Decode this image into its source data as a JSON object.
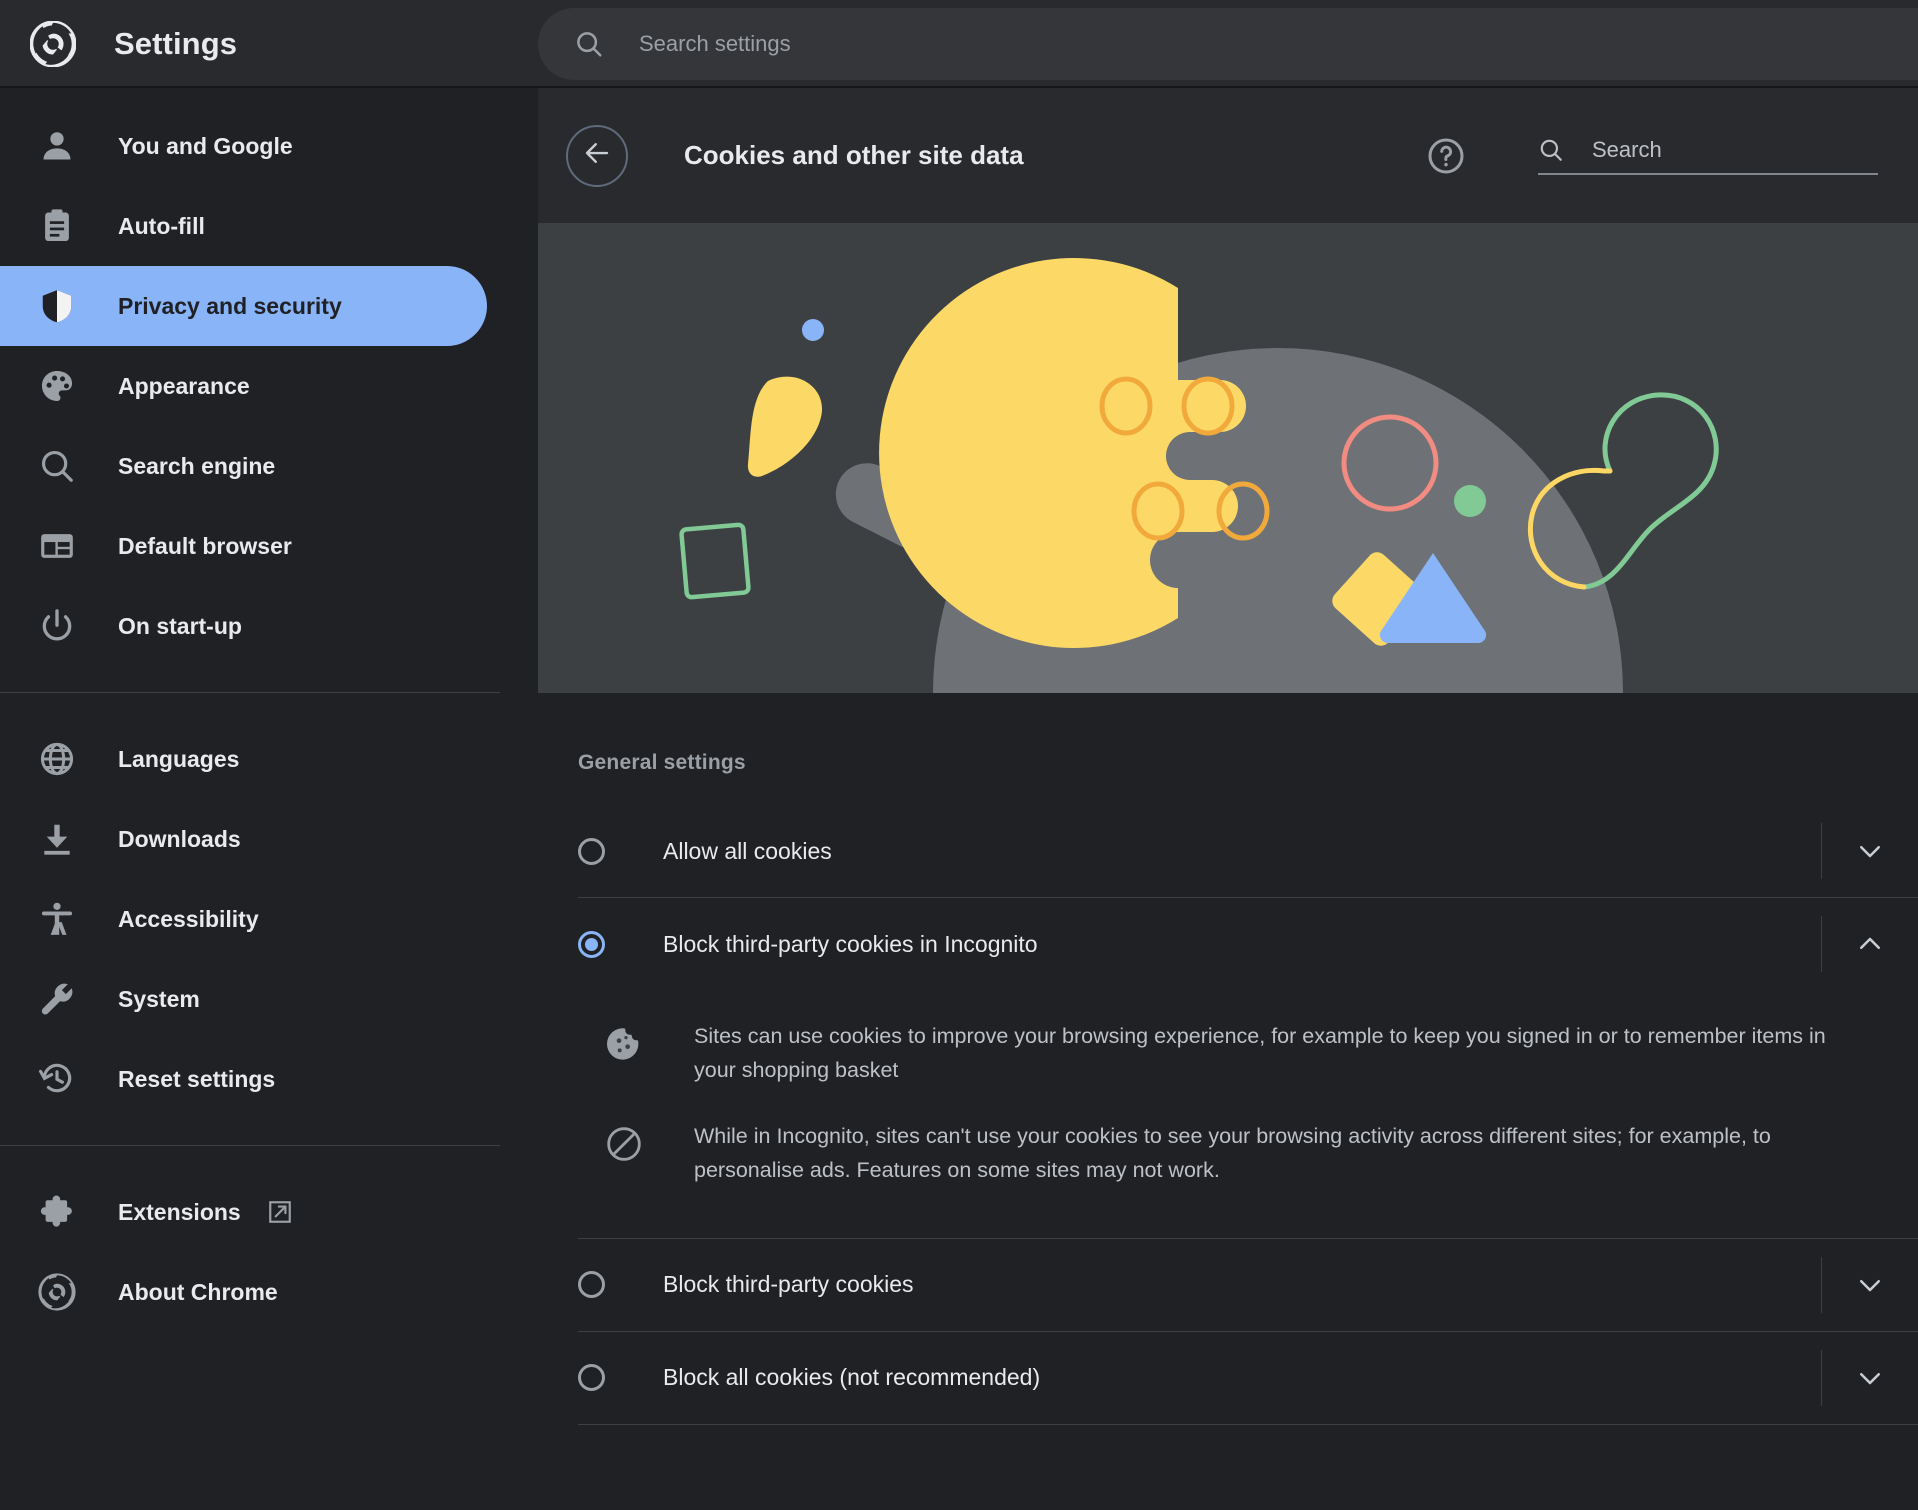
{
  "window": {
    "app_title": "Settings",
    "logo_icon": "chrome-logo-icon"
  },
  "top_search": {
    "placeholder": "Search settings",
    "icon": "search-icon",
    "value": ""
  },
  "sidebar": {
    "groups": [
      {
        "items": [
          {
            "label": "You and Google",
            "icon": "person-icon",
            "active": false
          },
          {
            "label": "Auto-fill",
            "icon": "clipboard-icon",
            "active": false
          },
          {
            "label": "Privacy and security",
            "icon": "shield-icon",
            "active": true
          },
          {
            "label": "Appearance",
            "icon": "palette-icon",
            "active": false
          },
          {
            "label": "Search engine",
            "icon": "magnifier-icon",
            "active": false
          },
          {
            "label": "Default browser",
            "icon": "browser-window-icon",
            "active": false
          },
          {
            "label": "On start-up",
            "icon": "power-icon",
            "active": false
          }
        ]
      },
      {
        "items": [
          {
            "label": "Languages",
            "icon": "globe-icon",
            "active": false
          },
          {
            "label": "Downloads",
            "icon": "download-icon",
            "active": false
          },
          {
            "label": "Accessibility",
            "icon": "accessibility-icon",
            "active": false
          },
          {
            "label": "System",
            "icon": "wrench-icon",
            "active": false
          },
          {
            "label": "Reset settings",
            "icon": "history-restore-icon",
            "active": false
          }
        ]
      },
      {
        "items": [
          {
            "label": "Extensions",
            "icon": "puzzle-icon",
            "external": true,
            "external_icon": "open-in-new-icon",
            "active": false
          },
          {
            "label": "About Chrome",
            "icon": "chrome-logo-icon",
            "active": false
          }
        ]
      }
    ]
  },
  "content_header": {
    "back_icon": "arrow-back-icon",
    "title": "Cookies and other site data",
    "help_icon": "help-circle-icon",
    "search": {
      "icon": "search-icon",
      "placeholder": "Search",
      "value": ""
    }
  },
  "hero": {
    "name": "cookies-illustration",
    "background": "#3c4043",
    "colors": {
      "cookie": "#fcd966",
      "cookie_chip": "#f2a93b",
      "blob_gray": "#6e7176",
      "pill_gray": "#6e7176",
      "blue_dot": "#8ab4f8",
      "blue_triangle": "#8ab4f8",
      "green_outline": "#81c995",
      "yellow_outline": "#fdd663",
      "red_outline": "#f28b82",
      "green_dot": "#81c995",
      "yellow_diamond": "#fcd966"
    }
  },
  "general_settings": {
    "section_label": "General settings",
    "options": [
      {
        "label": "Allow all cookies",
        "selected": false,
        "expanded": false,
        "chevron_icon": "chevron-down-icon"
      },
      {
        "label": "Block third-party cookies in Incognito",
        "selected": true,
        "expanded": true,
        "chevron_icon": "chevron-up-icon",
        "details": [
          {
            "icon": "cookie-icon",
            "text": "Sites can use cookies to improve your browsing experience, for example to keep you signed in or to remember items in your shopping basket"
          },
          {
            "icon": "block-icon",
            "text": "While in Incognito, sites can't use your cookies to see your browsing activity across different sites; for example, to personalise ads. Features on some sites may not work."
          }
        ]
      },
      {
        "label": "Block third-party cookies",
        "selected": false,
        "expanded": false,
        "chevron_icon": "chevron-down-icon"
      },
      {
        "label": "Block all cookies (not recommended)",
        "selected": false,
        "expanded": false,
        "chevron_icon": "chevron-down-icon"
      }
    ]
  },
  "theme": {
    "bg": "#202124",
    "surface": "#292a2d",
    "accent": "#8ab4f8",
    "text_primary": "#e8eaed",
    "text_secondary": "#9aa0a6",
    "divider": "#3c4043"
  }
}
